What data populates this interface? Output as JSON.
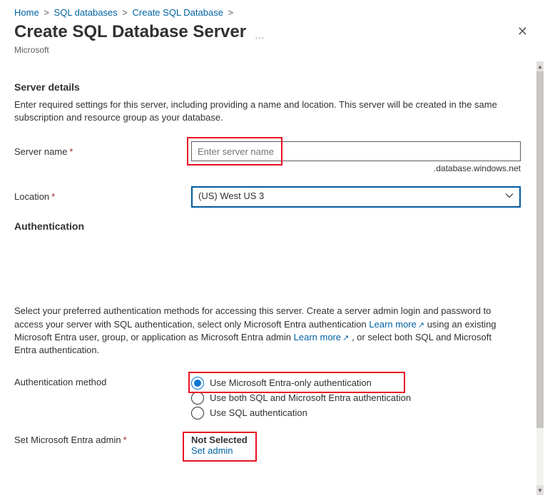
{
  "breadcrumb": {
    "items": [
      {
        "label": "Home"
      },
      {
        "label": "SQL databases"
      },
      {
        "label": "Create SQL Database"
      }
    ]
  },
  "header": {
    "title": "Create SQL Database Server",
    "subtitle": "Microsoft"
  },
  "sections": {
    "server_details_heading": "Server details",
    "server_details_desc": "Enter required settings for this server, including providing a name and location. This server will be created in the same subscription and resource group as your database.",
    "server_name_label": "Server name",
    "server_name_placeholder": "Enter server name",
    "server_name_suffix": ".database.windows.net",
    "location_label": "Location",
    "location_value": "(US) West US 3",
    "auth_heading": "Authentication",
    "auth_desc_1": "Select your preferred authentication methods for accessing this server. Create a server admin login and password to access your server with SQL authentication, select only Microsoft Entra authentication ",
    "auth_desc_link1": "Learn more",
    "auth_desc_2": " using an existing Microsoft Entra user, group, or application as Microsoft Entra admin ",
    "auth_desc_link2": "Learn more",
    "auth_desc_3": " , or select both SQL and Microsoft Entra authentication.",
    "auth_method_label": "Authentication method",
    "auth_options": [
      {
        "label": "Use Microsoft Entra-only authentication",
        "selected": true
      },
      {
        "label": "Use both SQL and Microsoft Entra authentication",
        "selected": false
      },
      {
        "label": "Use SQL authentication",
        "selected": false
      }
    ],
    "entra_admin_label": "Set Microsoft Entra admin",
    "entra_admin_status": "Not Selected",
    "entra_admin_link": "Set admin"
  }
}
